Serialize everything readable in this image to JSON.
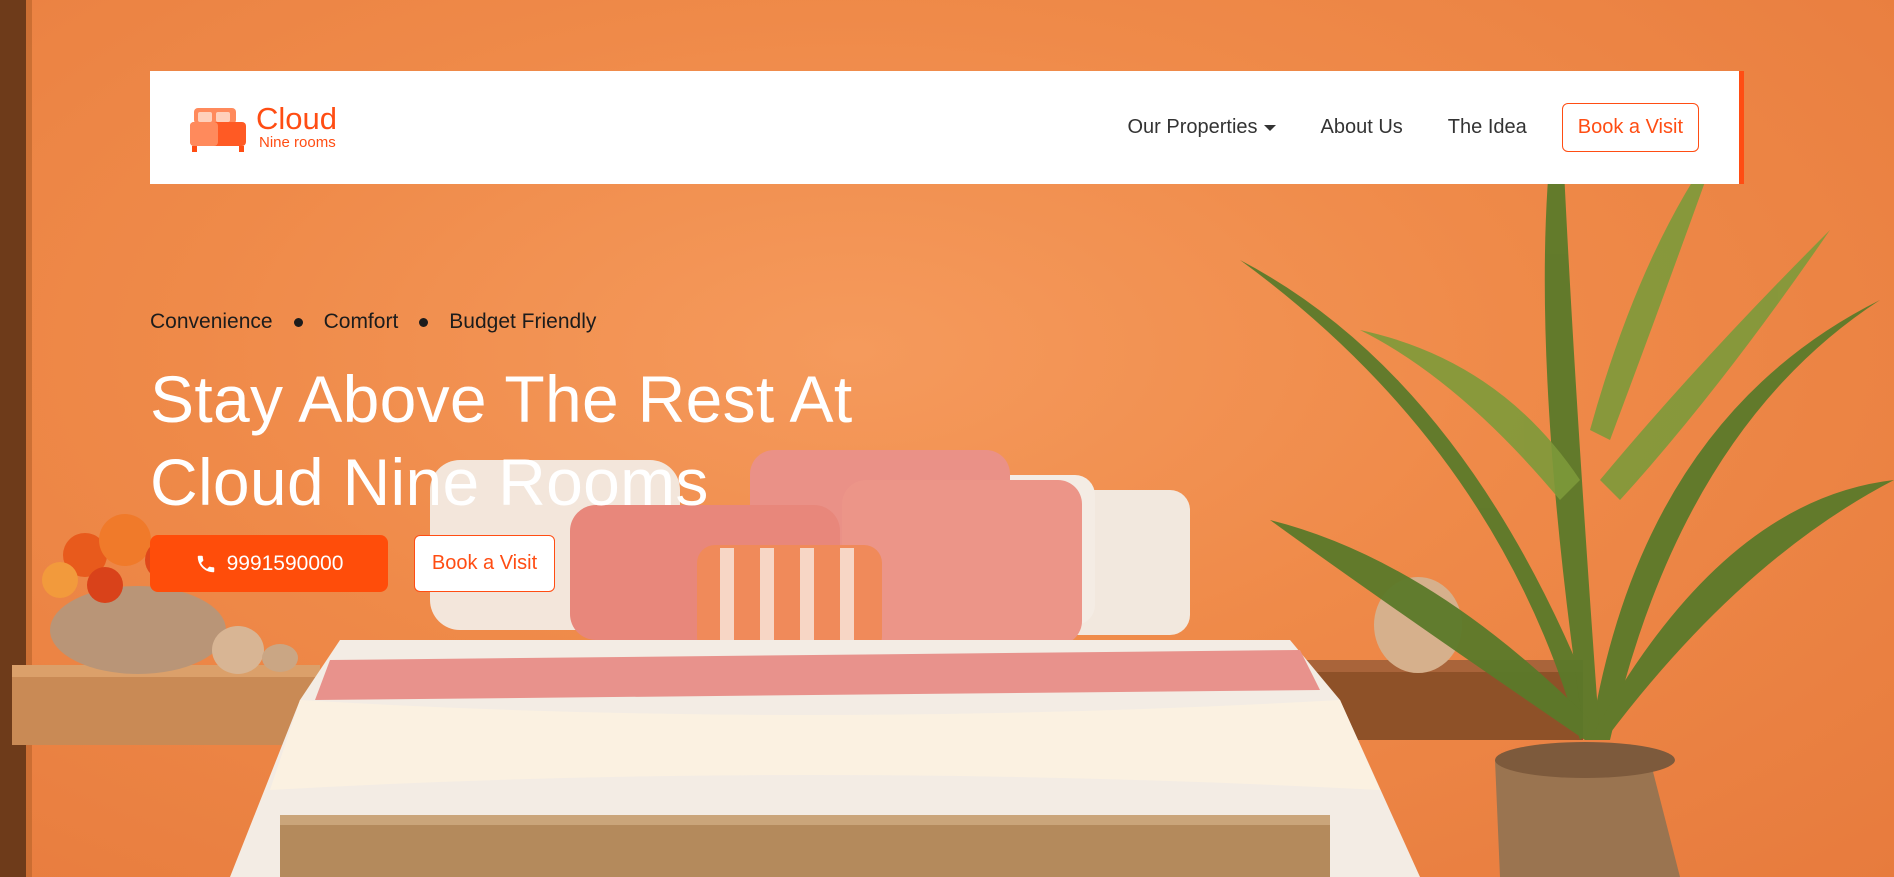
{
  "brand": {
    "name": "Cloud",
    "tagline": "Nine rooms",
    "color": "#ff4d13"
  },
  "nav": {
    "items": [
      {
        "label": "Our Properties",
        "has_dropdown": true
      },
      {
        "label": "About Us"
      },
      {
        "label": "The Idea"
      }
    ],
    "cta_label": "Book a Visit"
  },
  "hero": {
    "features": [
      "Convenience",
      "Comfort",
      "Budget Friendly"
    ],
    "headline_line1": "Stay Above The Rest At",
    "headline_line2": "Cloud Nine Rooms",
    "phone": "9991590000",
    "phone_icon": "phone-icon",
    "book_label": "Book a Visit"
  },
  "colors": {
    "accent": "#ff4d13",
    "wall": "#ef8a49",
    "text_dark": "#1c1c1c"
  }
}
